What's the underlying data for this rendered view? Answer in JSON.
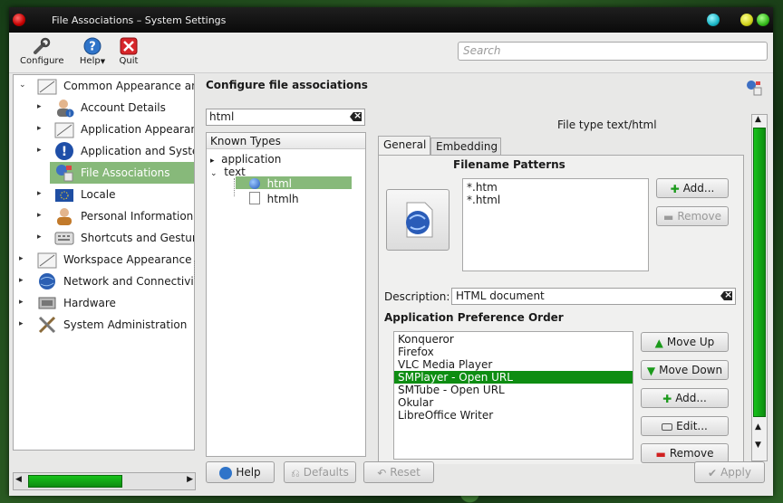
{
  "window": {
    "title": "File Associations – System Settings"
  },
  "toolbar": {
    "configure": "Configure",
    "help": "Help",
    "quit": "Quit",
    "search_placeholder": "Search"
  },
  "sidebar": {
    "items": [
      {
        "label": "Common Appearance and Behavior",
        "icon": "appearance-icon",
        "level": 0,
        "expanded": true
      },
      {
        "label": "Account Details",
        "icon": "user-info-icon",
        "level": 1
      },
      {
        "label": "Application Appearance",
        "icon": "appearance-icon",
        "level": 1
      },
      {
        "label": "Application and System Notifications",
        "icon": "warning-icon",
        "level": 1
      },
      {
        "label": "File Associations",
        "icon": "file-associations-icon",
        "level": 1,
        "selected": true
      },
      {
        "label": "Locale",
        "icon": "locale-icon",
        "level": 1
      },
      {
        "label": "Personal Information",
        "icon": "user-icon",
        "level": 1
      },
      {
        "label": "Shortcuts and Gestures",
        "icon": "keyboard-icon",
        "level": 1
      },
      {
        "label": "Workspace Appearance and Behavior",
        "icon": "appearance-icon",
        "level": 0
      },
      {
        "label": "Network and Connectivity",
        "icon": "network-globe-icon",
        "level": 0
      },
      {
        "label": "Hardware",
        "icon": "hardware-icon",
        "level": 0
      },
      {
        "label": "System Administration",
        "icon": "tools-icon",
        "level": 0
      }
    ]
  },
  "main": {
    "heading": "Configure file associations",
    "filter_value": "html",
    "tree_header": "Known Types",
    "tree": {
      "application": "application",
      "text": "text",
      "html": "html",
      "htmlh": "htmlh"
    },
    "file_type": "File type text/html",
    "tabs": {
      "general": "General",
      "embedding": "Embedding"
    },
    "filename_patterns_label": "Filename Patterns",
    "patterns": [
      "*.htm",
      "*.html"
    ],
    "add_label": "Add...",
    "remove_label": "Remove",
    "description_label": "Description:",
    "description_value": "HTML document",
    "app_pref_label": "Application Preference Order",
    "apps": [
      "Konqueror",
      "Firefox",
      "VLC Media Player",
      "SMPlayer - Open URL",
      "SMTube - Open URL",
      "Okular",
      "LibreOffice Writer"
    ],
    "selected_app": "SMPlayer - Open URL",
    "move_up": "Move Up",
    "move_down": "Move Down",
    "app_add": "Add...",
    "app_edit": "Edit...",
    "app_remove": "Remove"
  },
  "bottom": {
    "help": "Help",
    "defaults": "Defaults",
    "reset": "Reset",
    "apply": "Apply"
  },
  "colors": {
    "selection": "#87b97a",
    "app_selection": "#0e8d12",
    "accent_green": "#17b51a"
  }
}
